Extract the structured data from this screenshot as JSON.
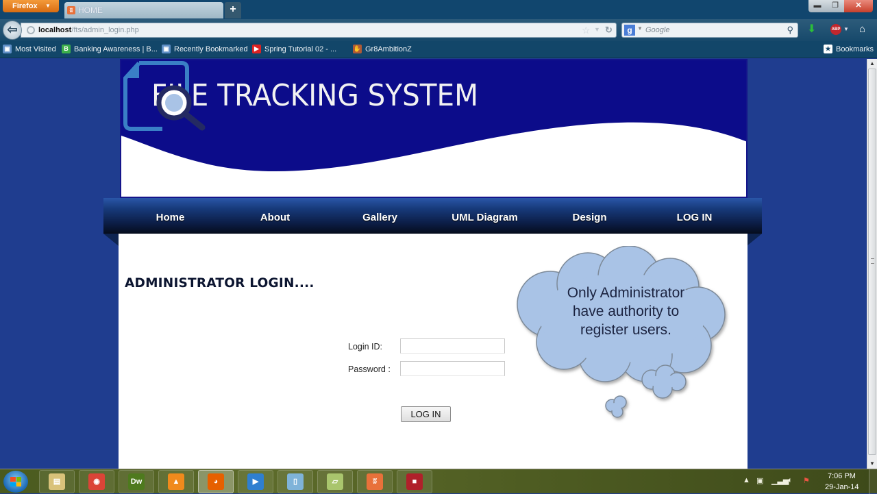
{
  "browser": {
    "app_button": "Firefox",
    "tab": {
      "title": "HOME"
    },
    "new_tab_label": "+",
    "window_controls": {
      "minimize": "▬",
      "maximize": "❐",
      "close": "✕"
    },
    "url": {
      "host": "localhost",
      "path": "/fts/admin_login.php"
    },
    "search": {
      "engine": "g",
      "placeholder": "Google"
    },
    "bookmarks_bar": [
      {
        "label": "Most Visited",
        "icon": "folder-icon"
      },
      {
        "label": "Banking Awareness | B...",
        "icon": "b-icon"
      },
      {
        "label": "Recently Bookmarked",
        "icon": "folder-icon"
      },
      {
        "label": "Spring Tutorial 02 - ...",
        "icon": "youtube-icon"
      },
      {
        "label": "Gr8AmbitionZ",
        "icon": "site-icon"
      }
    ],
    "bookmarks_menu": "Bookmarks"
  },
  "site": {
    "title": "FILE TRACKING SYSTEM",
    "nav": [
      "Home",
      "About",
      "Gallery",
      "UML Diagram",
      "Design",
      "LOG IN"
    ],
    "colors": {
      "banner": "#0c0c8a",
      "page_bg": "#1f3d8f",
      "cloud": "#a9c3e6"
    }
  },
  "login": {
    "heading": "ADMINISTRATOR LOGIN....",
    "login_id_label": "Login ID:",
    "login_id_value": "",
    "password_label": "Password :",
    "password_value": "",
    "submit_label": "LOG IN"
  },
  "cloud": {
    "lines": [
      "Only Administrator",
      "have authority to",
      "register users."
    ]
  },
  "taskbar": {
    "apps": [
      {
        "name": "explorer",
        "glyph": "▤",
        "color": "#d9c27a"
      },
      {
        "name": "chrome",
        "glyph": "◉",
        "color": "#db4437"
      },
      {
        "name": "dreamweaver",
        "glyph": "Dw",
        "color": "#4e7a1e"
      },
      {
        "name": "vlc",
        "glyph": "▲",
        "color": "#f08a1c"
      },
      {
        "name": "firefox",
        "glyph": "◕",
        "color": "#e66000"
      },
      {
        "name": "media-player",
        "glyph": "▶",
        "color": "#2f7fd0"
      },
      {
        "name": "notepad",
        "glyph": "▯",
        "color": "#7fb3d9"
      },
      {
        "name": "notes",
        "glyph": "▱",
        "color": "#a9c56d"
      },
      {
        "name": "xampp",
        "glyph": "ʬ",
        "color": "#e8713a"
      },
      {
        "name": "recorder",
        "glyph": "■",
        "color": "#b0202a"
      }
    ],
    "clock": {
      "time": "7:06 PM",
      "date": "29-Jan-14"
    }
  }
}
